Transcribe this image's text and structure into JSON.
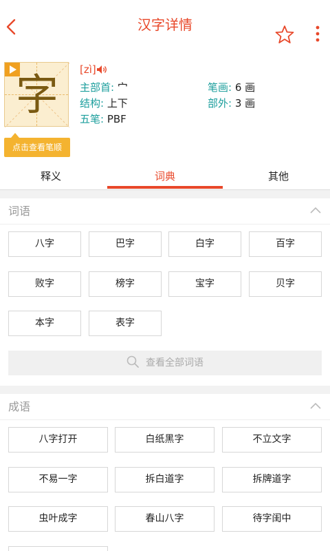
{
  "topbar": {
    "title": "汉字详情"
  },
  "character": {
    "glyph": "字",
    "pinyin": "[zì]",
    "stroke_button": "点击查看笔顺",
    "radical_label": "主部首:",
    "radical_value": "宀",
    "strokes_label": "笔画:",
    "strokes_value": "6 画",
    "structure_label": "结构:",
    "structure_value": "上下",
    "outer_label": "部外:",
    "outer_value": "3 画",
    "wubi_label": "五笔:",
    "wubi_value": "PBF"
  },
  "tabs": [
    "释义",
    "词典",
    "其他"
  ],
  "active_tab": 1,
  "ciyu": {
    "title": "词语",
    "items": [
      "八字",
      "巴字",
      "白字",
      "百字",
      "败字",
      "榜字",
      "宝字",
      "贝字",
      "本字",
      "表字"
    ],
    "view_all": "查看全部词语"
  },
  "chengyu": {
    "title": "成语",
    "items": [
      "八字打开",
      "白纸黑字",
      "不立文字",
      "不易一字",
      "拆白道字",
      "拆牌道字",
      "虫叶成字",
      "春山八字",
      "待字闺中"
    ]
  },
  "colors": {
    "accent": "#e8482a",
    "label": "#1b9e9c",
    "button": "#f4b330"
  }
}
